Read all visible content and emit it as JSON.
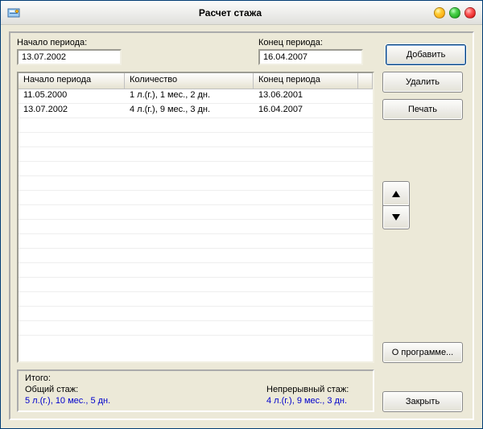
{
  "window": {
    "title": "Расчет стажа"
  },
  "fields": {
    "start_label": "Начало периода:",
    "end_label": "Конец периода:",
    "start_value": "13.07.2002",
    "end_value": "16.04.2007"
  },
  "buttons": {
    "add": "Добавить",
    "delete": "Удалить",
    "print": "Печать",
    "about": "О программе...",
    "close": "Закрыть"
  },
  "table": {
    "col_start": "Начало периода",
    "col_qty": "Количество",
    "col_end": "Конец периода",
    "rows": [
      {
        "start": "11.05.2000",
        "qty": "1 л.(г.), 1 мес., 2 дн.",
        "end": "13.06.2001"
      },
      {
        "start": "13.07.2002",
        "qty": "4 л.(г.), 9 мес., 3 дн.",
        "end": "16.04.2007"
      }
    ]
  },
  "summary": {
    "title": "Итого:",
    "total_label": "Общий стаж:",
    "total_value": "5 л.(г.), 10 мес., 5 дн.",
    "continuous_label": "Непрерывный стаж:",
    "continuous_value": "4 л.(г.), 9 мес., 3 дн."
  }
}
